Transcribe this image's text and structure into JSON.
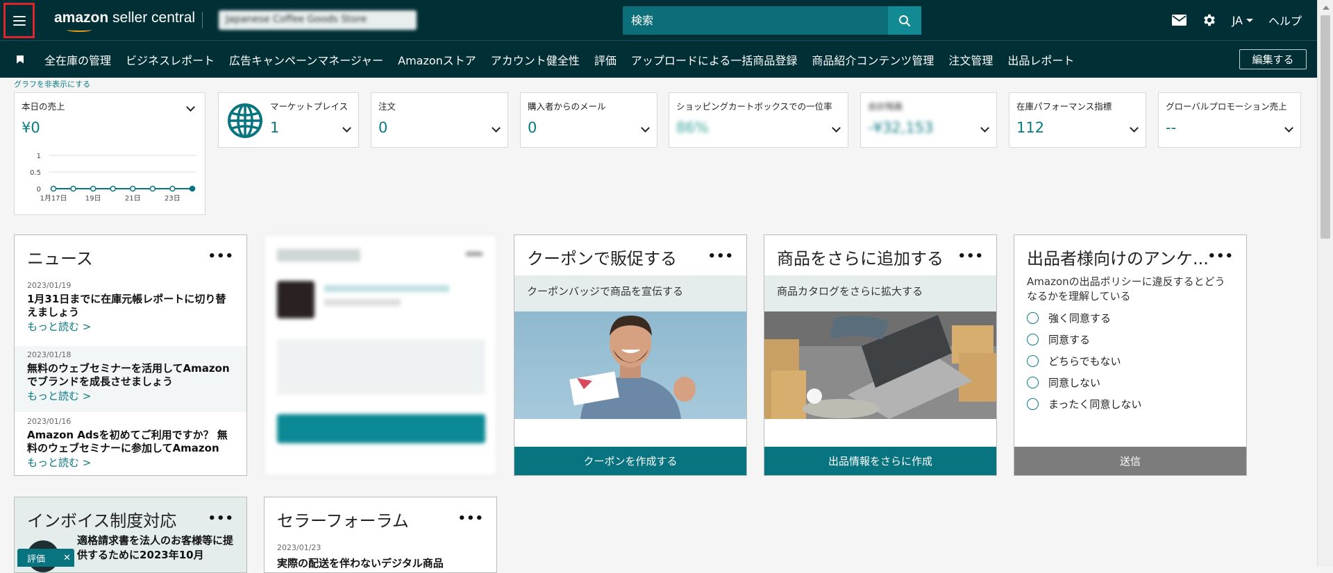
{
  "header": {
    "logo_bold": "amazon",
    "logo_rest": " seller central",
    "store_name": "Japanese Coffee Goods Store",
    "search_placeholder": "検索",
    "lang": "JA",
    "help": "ヘルプ"
  },
  "nav": {
    "items": [
      "全在庫の管理",
      "ビジネスレポート",
      "広告キャンペーンマネージャー",
      "Amazonストア",
      "アカウント健全性",
      "評価",
      "アップロードによる一括商品登録",
      "商品紹介コンテンツ管理",
      "注文管理",
      "出品レポート"
    ],
    "edit": "編集する"
  },
  "dashboard": {
    "hide_graph": "グラフを非表示にする",
    "sales": {
      "label": "本日の売上",
      "value": "¥0",
      "y_ticks": [
        "1",
        "0.5",
        "0"
      ],
      "x_ticks": [
        "1月17日",
        "19日",
        "21日",
        "23日"
      ]
    },
    "metrics": [
      {
        "label": "マーケットプレイス",
        "value": "1"
      },
      {
        "label": "注文",
        "value": "0"
      },
      {
        "label": "購入者からのメール",
        "value": "0"
      },
      {
        "label": "ショッピングカートボックスでの一位率",
        "value": "86%"
      },
      {
        "label": "合計残高",
        "value": "-¥32,153"
      },
      {
        "label": "在庫パフォーマンス指標",
        "value": "112"
      },
      {
        "label": "グローバルプロモーション売上",
        "value": "--"
      }
    ]
  },
  "chart_data": {
    "type": "line",
    "title": "本日の売上",
    "x": [
      "1月17日",
      "1月18日",
      "1月19日",
      "1月20日",
      "1月21日",
      "1月22日",
      "1月23日",
      "1月24日"
    ],
    "series": [
      {
        "values": [
          0,
          0,
          0,
          0,
          0,
          0,
          0,
          0
        ]
      }
    ],
    "ylim": [
      0,
      1
    ],
    "xlabel": "",
    "ylabel": ""
  },
  "news": {
    "title": "ニュース",
    "items": [
      {
        "date": "2023/01/19",
        "headline": "1月31日までに在庫元帳レポートに切り替えましょう",
        "more": "もっと読む >"
      },
      {
        "date": "2023/01/18",
        "headline": "無料のウェブセミナーを活用してAmazonでブランドを成長させましょう",
        "more": "もっと読む >"
      },
      {
        "date": "2023/01/16",
        "headline": "Amazon Adsを初めてご利用ですか？ 無料のウェブセミナーに参加してAmazon",
        "more": "もっと読む >"
      }
    ]
  },
  "coupon": {
    "title": "クーポンで販促する",
    "sub": "クーポンバッジで商品を宣伝する",
    "button": "クーポンを作成する"
  },
  "addproducts": {
    "title": "商品をさらに追加する",
    "sub": "商品カタログをさらに拡大する",
    "button": "出品情報をさらに作成"
  },
  "survey": {
    "title": "出品者様向けのアンケ...",
    "question": "Amazonの出品ポリシーに違反するとどうなるかを理解している",
    "options": [
      "強く同意する",
      "同意する",
      "どちらでもない",
      "同意しない",
      "まったく同意しない"
    ],
    "button": "送信"
  },
  "invoice": {
    "title": "インボイス制度対応",
    "text": "適格請求書を法人のお客様等に提供するために2023年10月"
  },
  "forum": {
    "title": "セラーフォーラム",
    "date": "2023/01/23",
    "headline": "実際の配送を伴わないデジタル商品"
  },
  "feedback": {
    "label": "評価",
    "close": "✕"
  },
  "colors": {
    "header_bg": "#002f36",
    "accent": "#077480",
    "link": "#0a7a82"
  }
}
